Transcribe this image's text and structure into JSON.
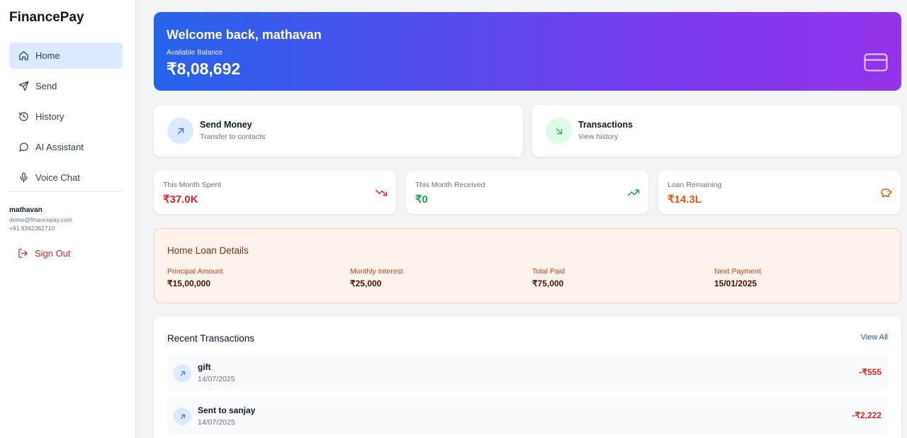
{
  "app": {
    "brand": "FinancePay"
  },
  "sidebar": {
    "items": [
      {
        "label": "Home",
        "icon": "home-icon",
        "active": true
      },
      {
        "label": "Send",
        "icon": "send-icon"
      },
      {
        "label": "History",
        "icon": "history-icon"
      },
      {
        "label": "AI Assistant",
        "icon": "chat-icon"
      },
      {
        "label": "Voice Chat",
        "icon": "mic-icon"
      }
    ],
    "user": {
      "name": "mathavan",
      "email": "demo@financepay.com",
      "phone": "+91 9342362710"
    },
    "signout_label": "Sign Out"
  },
  "banner": {
    "title": "Welcome back, mathavan",
    "balance_label": "Available Balance",
    "balance": "₹8,08,692",
    "icon": "credit-card-icon"
  },
  "actions": [
    {
      "title": "Send Money",
      "subtitle": "Transfer to contacts",
      "icon": "arrow-up-right-icon"
    },
    {
      "title": "Transactions",
      "subtitle": "View history",
      "icon": "arrow-down-right-icon"
    }
  ],
  "stats": [
    {
      "label": "This Month Spent",
      "value": "₹37.0K",
      "icon": "trending-down-icon"
    },
    {
      "label": "This Month Received",
      "value": "₹0",
      "icon": "trending-up-icon"
    },
    {
      "label": "Loan Remaining",
      "value": "₹14.3L",
      "icon": "piggy-bank-icon"
    }
  ],
  "loan": {
    "title": "Home Loan Details",
    "fields": [
      {
        "label": "Principal Amount",
        "value": "₹15,00,000"
      },
      {
        "label": "Monthly Interest",
        "value": "₹25,000"
      },
      {
        "label": "Total Paid",
        "value": "₹75,000"
      },
      {
        "label": "Next Payment",
        "value": "15/01/2025"
      }
    ]
  },
  "recent": {
    "title": "Recent Transactions",
    "view_all": "View All",
    "rows": [
      {
        "name": "gift",
        "date": "14/07/2025",
        "amount": "-₹555"
      },
      {
        "name": "Sent to sanjay",
        "date": "14/07/2025",
        "amount": "-₹2,222"
      }
    ]
  },
  "colors": {
    "primary": "#2563eb",
    "gradient_end": "#9333ea",
    "spent": "#dc2626",
    "received": "#16a34a",
    "loan": "#ea580c"
  }
}
